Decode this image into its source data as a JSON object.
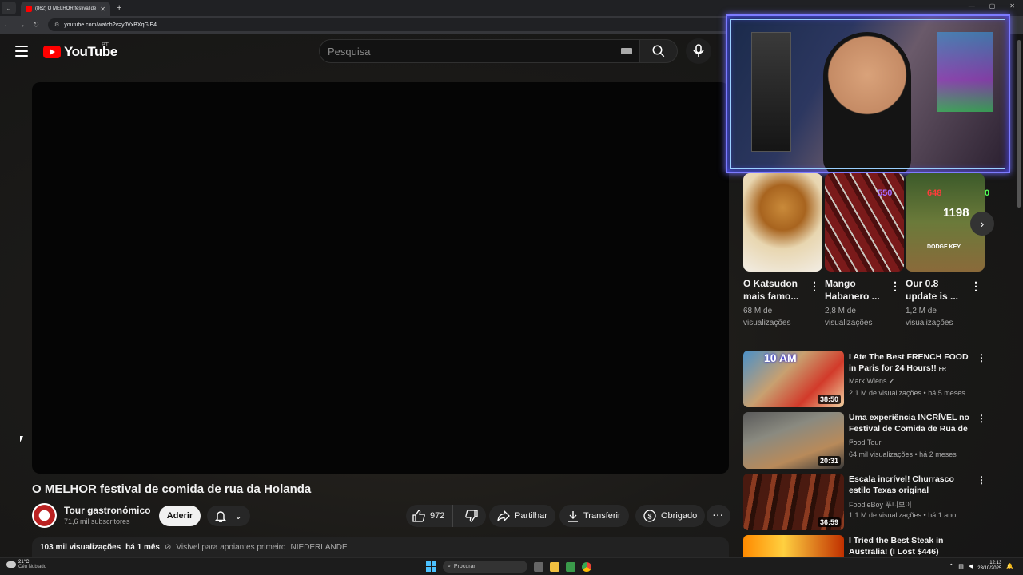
{
  "browser": {
    "tab_title": "(862) O MELHOR festival de co...",
    "new_tab": "+",
    "url": "youtube.com/watch?v=yJVxBXqGlE4"
  },
  "header": {
    "logo_text": "YouTube",
    "region": "PT",
    "search_placeholder": "Pesquisa"
  },
  "video": {
    "title": "O MELHOR festival de comida de rua da Holanda",
    "channel_name": "Tour gastronómico",
    "channel_subs": "71,6 mil subscritores",
    "join_label": "Aderir",
    "likes": "972",
    "share_label": "Partilhar",
    "download_label": "Transferir",
    "thanks_label": "Obrigado",
    "views": "103 mil visualizações",
    "age": "há 1 mês",
    "visibility": "Visível para apoiantes primeiro",
    "tag": "NIEDERLANDE"
  },
  "shorts": [
    {
      "title_1": "O Katsudon",
      "title_2": "mais famo...",
      "views_1": "68 M de",
      "views_2": "visualizações"
    },
    {
      "title_1": "Mango",
      "title_2": "Habanero ...",
      "views_1": "2,8 M de",
      "views_2": "visualizações"
    },
    {
      "title_1": "Our 0.8",
      "title_2": "update is ...",
      "views_1": "1,2 M de",
      "views_2": "visualizações"
    }
  ],
  "overlay_stats": {
    "row1_a": "550",
    "row1_b": "648",
    "row1_c": "0",
    "row2_total": "1198",
    "dodge_label": "DODGE KEY"
  },
  "recommendations": [
    {
      "title": "I Ate The Best FRENCH FOOD in Paris for 24 Hours!!",
      "title_badge": "FR",
      "thumb_label": "10 AM",
      "channel": "Mark Wiens",
      "meta": "2,1 M de visualizações • há 5 meses",
      "duration": "38:50"
    },
    {
      "title": "Uma experiência INCRÍVEL no Festival de Comida de Rua de ...",
      "title_badge": "",
      "thumb_label": "",
      "channel": "Food Tour",
      "meta": "64 mil visualizações • há 2 meses",
      "duration": "20:31"
    },
    {
      "title": "Escala incrível! Churrasco estilo Texas original",
      "title_badge": "",
      "thumb_label": "",
      "channel": "FoodieBoy 푸디보이",
      "meta": "1,1 M de visualizações • há 1 ano",
      "duration": "36:59"
    },
    {
      "title": "I Tried the Best Steak in Australia! (I Lost $446)",
      "title_badge": "",
      "thumb_label": "",
      "channel": "",
      "meta": "",
      "duration": ""
    }
  ],
  "taskbar": {
    "temp": "21°C",
    "weather": "Céu Nublado",
    "search": "Procurar",
    "time": "12:13",
    "date": "23/10/2025"
  },
  "colors": {
    "accent_red": "#ff0000",
    "webcam_border": "#7d7cff"
  }
}
